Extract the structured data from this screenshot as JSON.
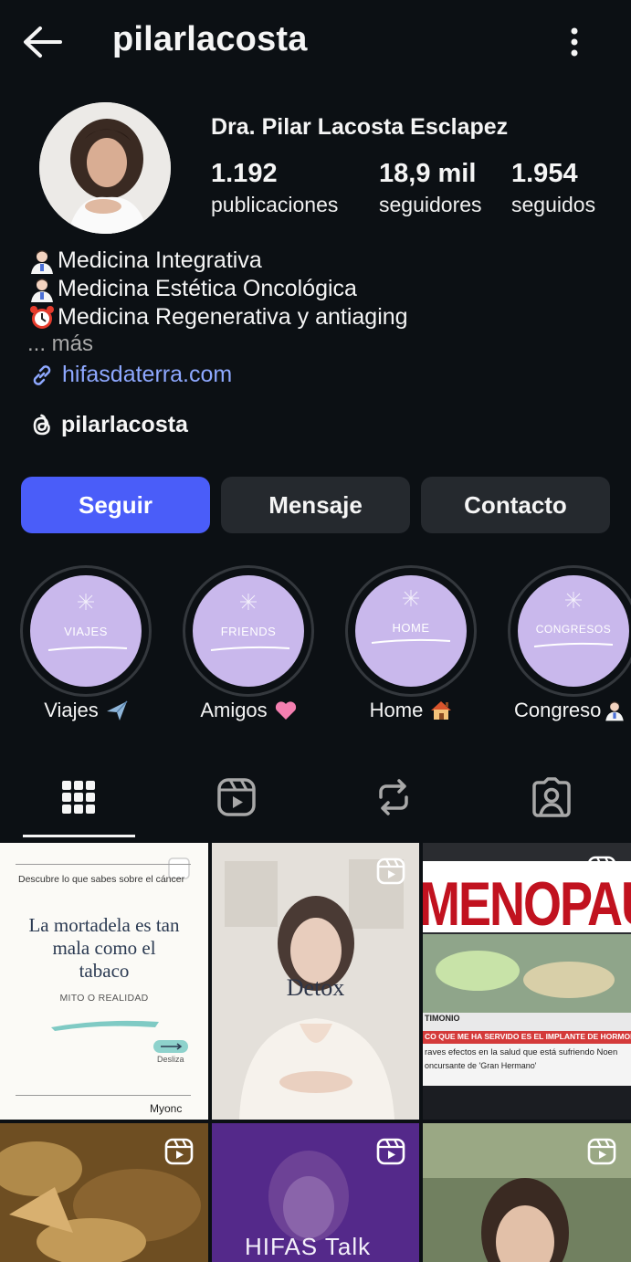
{
  "header": {
    "username": "pilarlacosta"
  },
  "profile": {
    "full_name": "Dra. Pilar Lacosta Esclapez",
    "stats": [
      {
        "value": "1.192",
        "label": "publicaciones"
      },
      {
        "value": "18,9 mil",
        "label": "seguidores"
      },
      {
        "value": "1.954",
        "label": "seguidos"
      }
    ],
    "bio": [
      {
        "emoji": "health-worker-emoji",
        "text": "Medicina Integrativa"
      },
      {
        "emoji": "health-worker-emoji",
        "text": "Medicina Estética Oncológica"
      },
      {
        "emoji": "alarm-clock-emoji",
        "text": "Medicina Regenerativa y antiaging"
      }
    ],
    "more_label": "... más",
    "website": "hifasdaterra.com",
    "threads_handle": "pilarlacosta"
  },
  "actions": {
    "follow": "Seguir",
    "message": "Mensaje",
    "contact": "Contacto"
  },
  "highlights": [
    {
      "cover_text": "VIAJES",
      "label": "Viajes",
      "emoji": "airplane-emoji"
    },
    {
      "cover_text": "FRIENDS",
      "label": "Amigos",
      "emoji": "pink-heart-emoji"
    },
    {
      "cover_text": "HOME",
      "label": "Home",
      "emoji": "house-emoji"
    },
    {
      "cover_text": "CONGRESOS",
      "label": "Congreso",
      "emoji": "health-worker-emoji"
    }
  ],
  "tabs": [
    {
      "icon": "grid-icon",
      "active": true
    },
    {
      "icon": "reels-icon",
      "active": false
    },
    {
      "icon": "reposts-icon",
      "active": false
    },
    {
      "icon": "tagged-icon",
      "active": false
    }
  ],
  "posts": [
    {
      "type": "carousel",
      "kicker": "Descubre lo que sabes sobre el cáncer",
      "title_line1": "La mortadela es tan",
      "title_line2": "mala como el",
      "title_line3": "tabaco",
      "subtitle": "MITO O REALIDAD",
      "swipe": "Desliza",
      "brand": "Myonc"
    },
    {
      "type": "reel",
      "overlay": "Detox"
    },
    {
      "type": "reel",
      "headline": "MENOPAUSIA",
      "ticker_label": "TIMONIO",
      "ticker_line1": "CO QUE ME HA SERVIDO ES EL IMPLANTE DE HORMONAS, PERO LO",
      "ticker_line2": "raves efectos en la salud que está sufriendo Noen",
      "ticker_line3": "oncursante de 'Gran Hermano'"
    },
    {
      "type": "reel",
      "overlay": ""
    },
    {
      "type": "reel",
      "overlay": "HIFAS Talk"
    },
    {
      "type": "reel",
      "overlay": ""
    }
  ],
  "colors": {
    "background": "#0c1014",
    "follow_button": "#4a5df9",
    "secondary_button": "#25292e",
    "link": "#8ea8ff",
    "highlight_cover": "#c9b8ec"
  }
}
